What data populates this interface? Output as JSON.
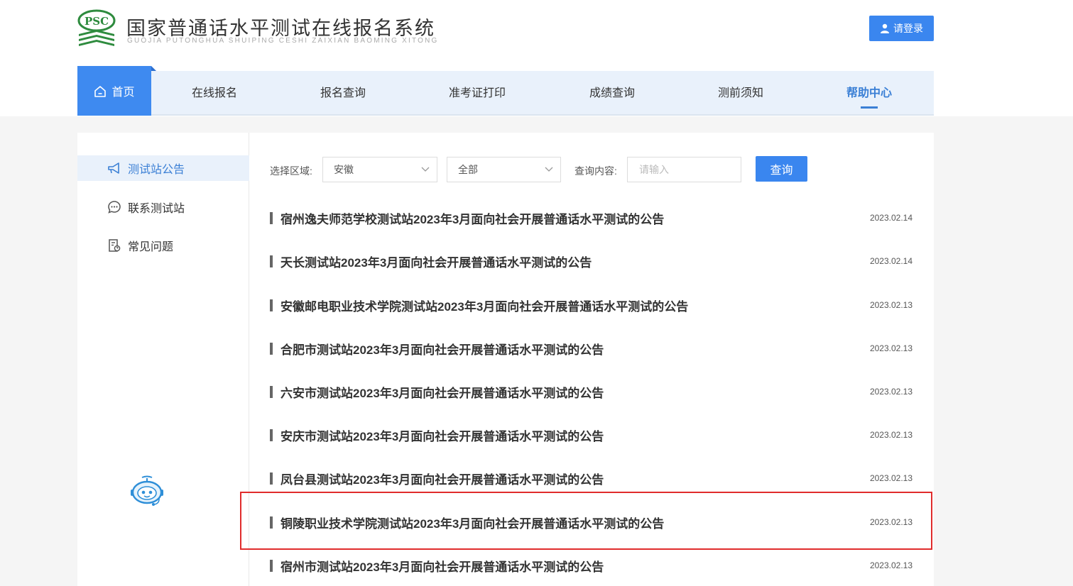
{
  "header": {
    "logo_badge": "PSC",
    "title": "国家普通话水平测试在线报名系统",
    "subtitle": "GUOJIA PUTONGHUA SHUIPING CESHI ZAIXIAN BAOMING XITONG",
    "login_label": "请登录",
    "brand_green": "#2e8b3e",
    "accent_blue": "#3a86ef"
  },
  "nav": {
    "home": "首页",
    "items": [
      "在线报名",
      "报名查询",
      "准考证打印",
      "成绩查询",
      "测前须知",
      "帮助中心"
    ],
    "active": "帮助中心"
  },
  "sidebar": {
    "items": [
      {
        "label": "测试站公告",
        "icon": "megaphone-icon",
        "active": true
      },
      {
        "label": "联系测试站",
        "icon": "chat-bubble-icon",
        "active": false
      },
      {
        "label": "常见问题",
        "icon": "document-question-icon",
        "active": false
      }
    ],
    "assistant_icon": "robot-assistant-icon"
  },
  "filters": {
    "region_label": "选择区域:",
    "region_value": "安徽",
    "category_value": "全部",
    "query_label": "查询内容:",
    "query_placeholder": "请输入",
    "search_button": "查询"
  },
  "notices": [
    {
      "title": "宿州逸夫师范学校测试站2023年3月面向社会开展普通话水平测试的公告",
      "date": "2023.02.14"
    },
    {
      "title": "天长测试站2023年3月面向社会开展普通话水平测试的公告",
      "date": "2023.02.14"
    },
    {
      "title": "安徽邮电职业技术学院测试站2023年3月面向社会开展普通话水平测试的公告",
      "date": "2023.02.13"
    },
    {
      "title": "合肥市测试站2023年3月面向社会开展普通话水平测试的公告",
      "date": "2023.02.13"
    },
    {
      "title": "六安市测试站2023年3月面向社会开展普通话水平测试的公告",
      "date": "2023.02.13"
    },
    {
      "title": "安庆市测试站2023年3月面向社会开展普通话水平测试的公告",
      "date": "2023.02.13"
    },
    {
      "title": "凤台县测试站2023年3月面向社会开展普通话水平测试的公告",
      "date": "2023.02.13"
    },
    {
      "title": "铜陵职业技术学院测试站2023年3月面向社会开展普通话水平测试的公告",
      "date": "2023.02.13"
    },
    {
      "title": "宿州市测试站2023年3月面向社会开展普通话水平测试的公告",
      "date": "2023.02.13"
    }
  ],
  "highlighted_notice": "铜陵职业技术学院测试站2023年3月面向社会开展普通话水平测试的公告"
}
